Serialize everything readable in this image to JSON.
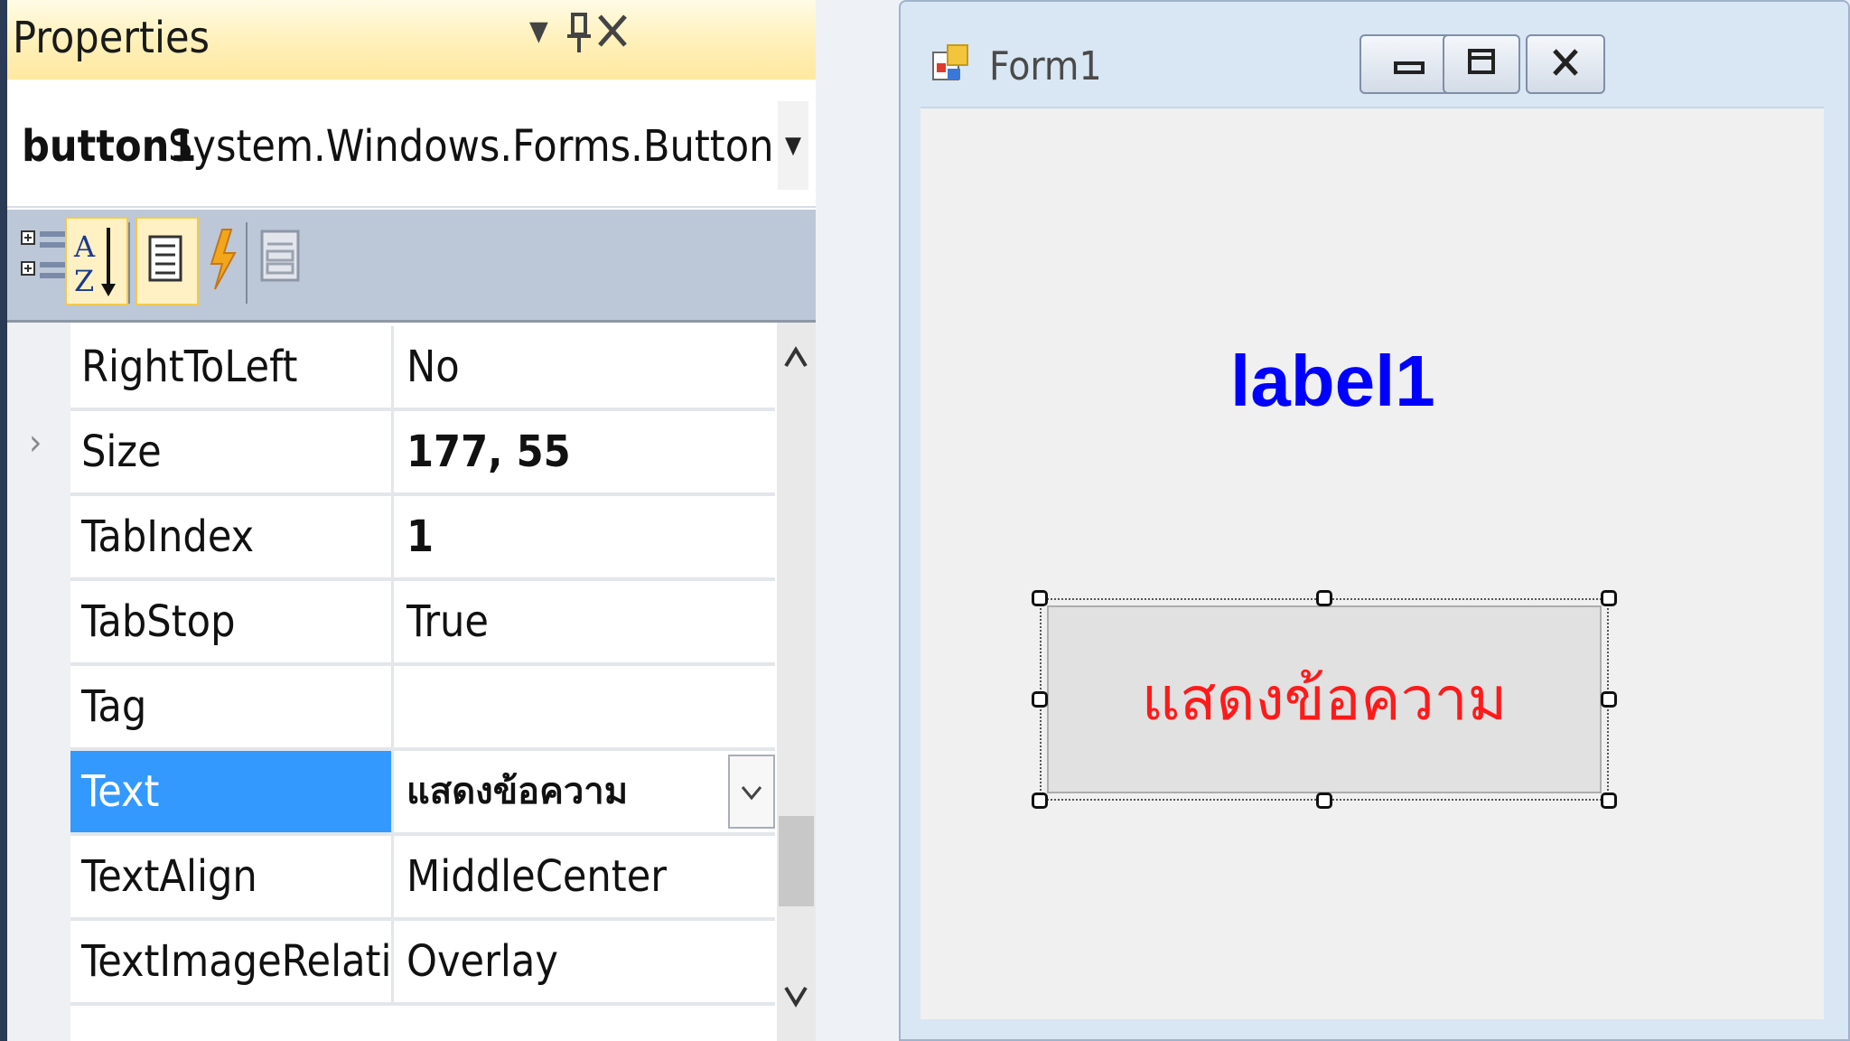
{
  "properties_panel": {
    "title": "Properties",
    "object_name": "button1",
    "object_type": "System.Windows.Forms.Button",
    "toolbar": [
      {
        "icon": "categorized-icon",
        "active": false
      },
      {
        "icon": "alphabetical-sort-icon",
        "active": true
      },
      {
        "icon": "properties-icon",
        "active": true
      },
      {
        "icon": "events-lightning-icon",
        "active": false
      },
      {
        "icon": "property-pages-icon",
        "active": false
      }
    ],
    "rows": [
      {
        "name": "RightToLeft",
        "value": "No"
      },
      {
        "name": "Size",
        "value": "177, 55",
        "expandable": true
      },
      {
        "name": "TabIndex",
        "value": "1"
      },
      {
        "name": "TabStop",
        "value": "True"
      },
      {
        "name": "Tag",
        "value": ""
      },
      {
        "name": "Text",
        "value": "แสดงข้อความ",
        "selected": true
      },
      {
        "name": "TextAlign",
        "value": "MiddleCenter"
      },
      {
        "name": "TextImageRelation",
        "value": "Overlay"
      }
    ]
  },
  "form_designer": {
    "window_title": "Form1",
    "label_text": "label1",
    "button_text": "แสดงข้อความ",
    "colors": {
      "label": "#0000ff",
      "button_text": "#ff1a1a",
      "selection": "#3399ff"
    }
  }
}
